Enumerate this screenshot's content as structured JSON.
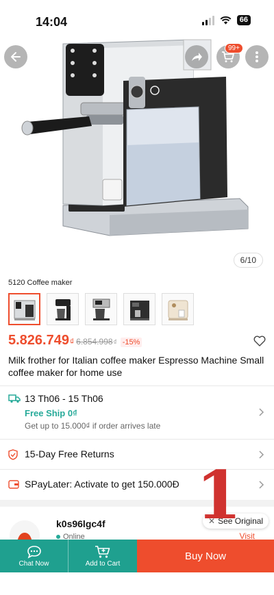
{
  "status_bar": {
    "time": "14:04",
    "battery": "66"
  },
  "header": {
    "cart_badge": "99+"
  },
  "gallery": {
    "counter": "6/10"
  },
  "variant": {
    "label": "5120 Coffee maker",
    "thumbnails": [
      "espresso-machine-chrome",
      "drip-coffee-maker-black",
      "drip-coffee-maker-steel",
      "espresso-machine-black",
      "espresso-machine-cream"
    ]
  },
  "price": {
    "current": "5.826.749",
    "currency": "₫",
    "original": "6.854.998",
    "original_currency": "₫",
    "discount": "-15%"
  },
  "product": {
    "title": "Milk frother for Italian coffee maker Espresso Machine Small coffee maker for home use"
  },
  "shipping": {
    "dates": "13 Th06 - 15 Th06",
    "free_ship": "Free Ship 0₫",
    "note": "Get up to 15.000₫ if order arrives late"
  },
  "returns": {
    "label": "15-Day Free Returns"
  },
  "paylater": {
    "label": "SPayLater: Activate to get 150.000Đ"
  },
  "seller": {
    "name": "k0s96lgc4f",
    "status": "Online",
    "visit_label": "Visit"
  },
  "translate": {
    "label": "See Original"
  },
  "overlay": {
    "number": "1"
  },
  "bottom_bar": {
    "chat_label": "Chat Now",
    "cart_label": "Add to Cart",
    "buy_label": "Buy Now"
  },
  "colors": {
    "brand": "#ee4d2d",
    "teal": "#1fa08f",
    "free_ship": "#26aa99"
  }
}
